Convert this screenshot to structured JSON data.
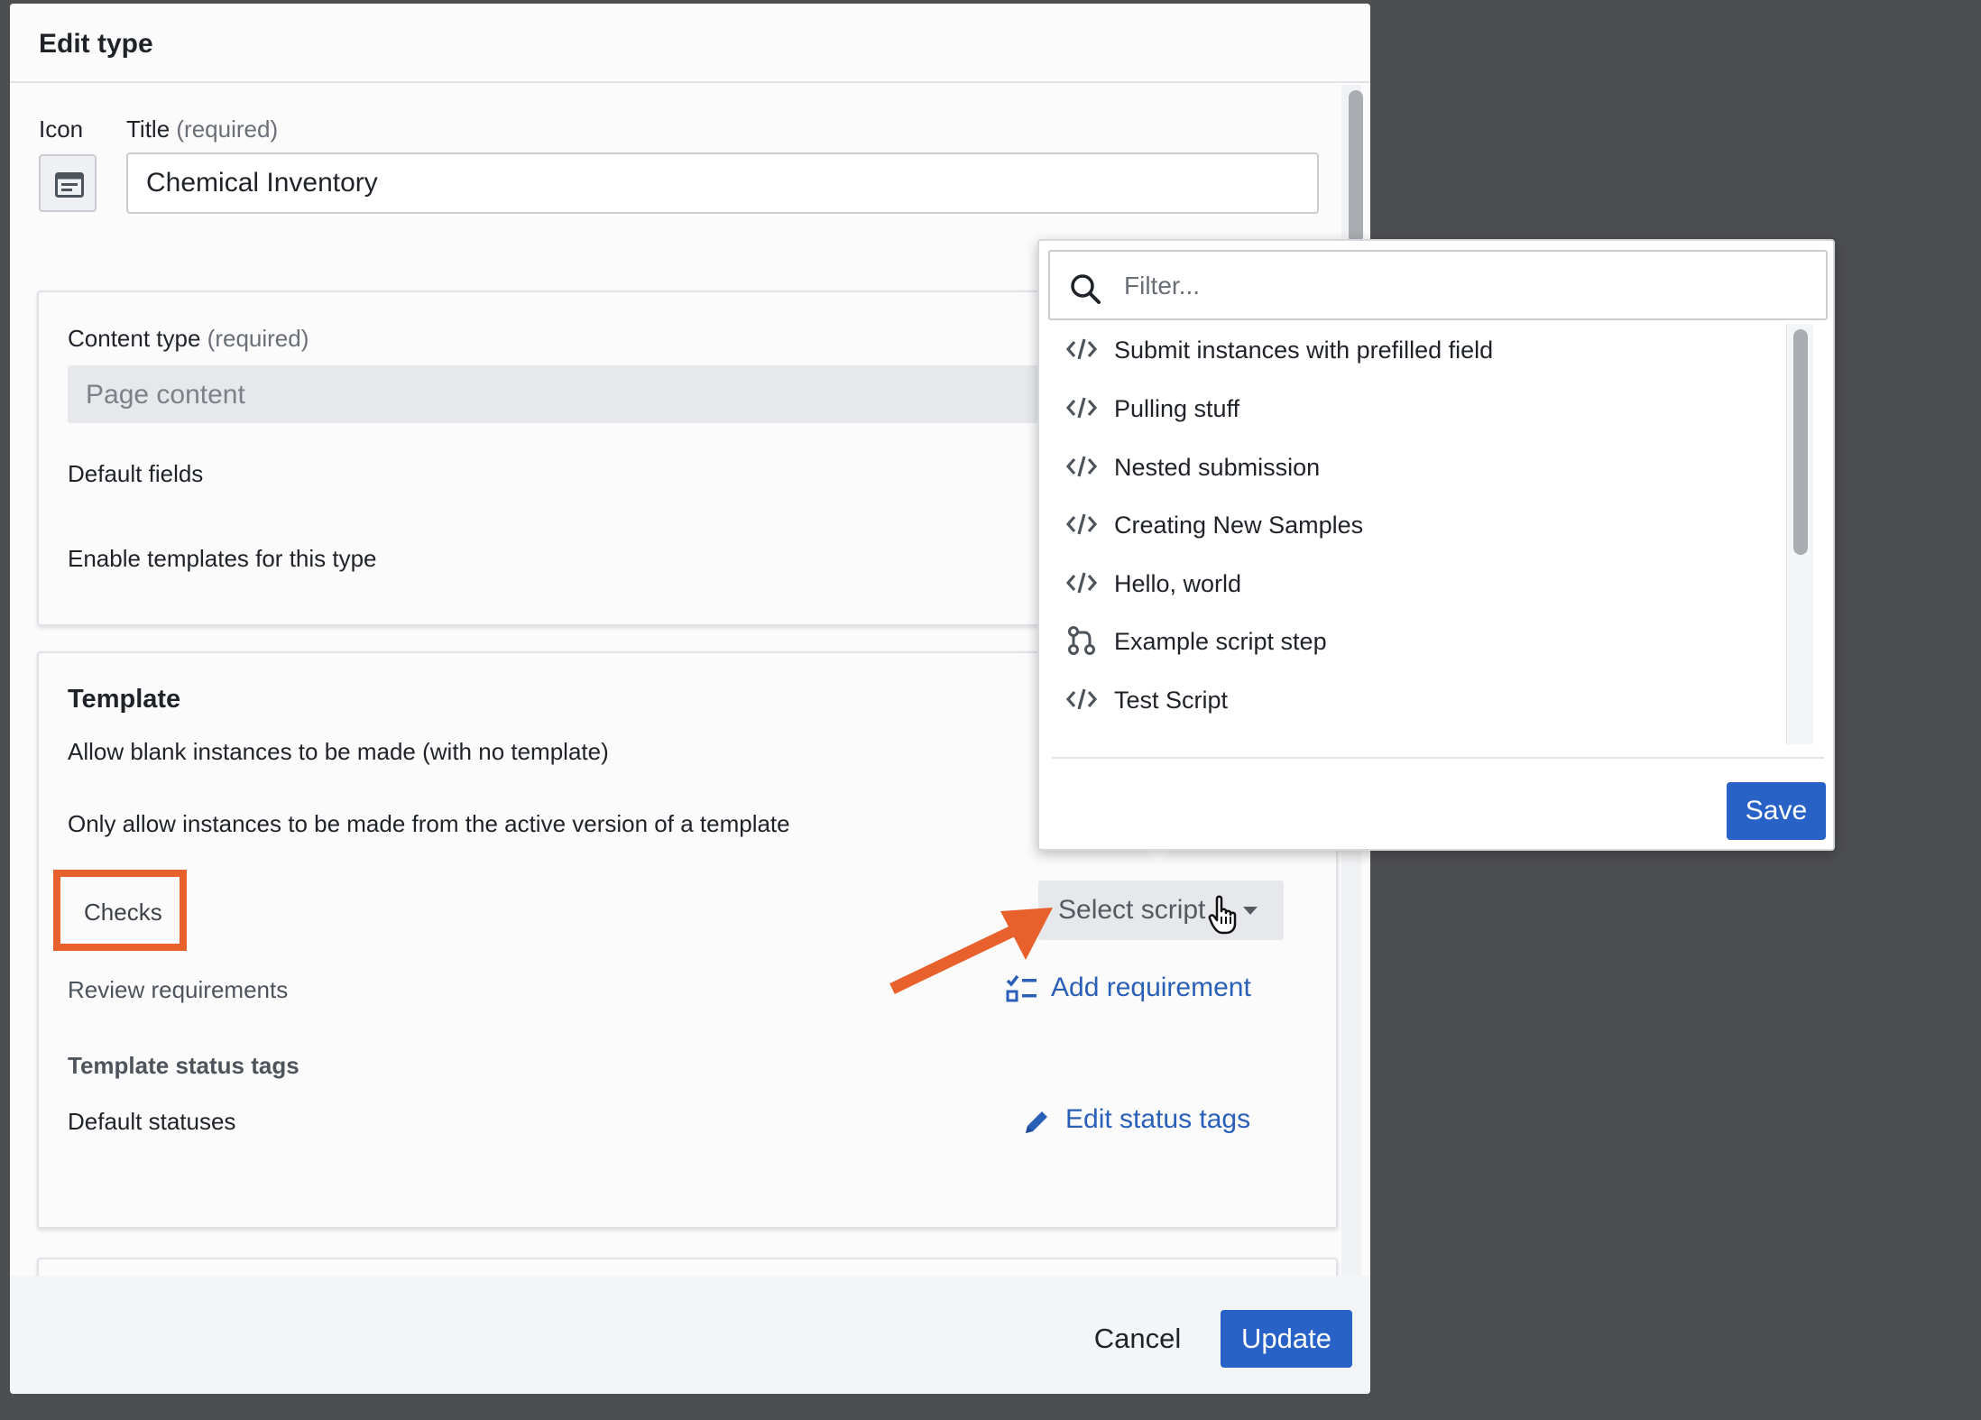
{
  "modal": {
    "title": "Edit type",
    "icon_label": "Icon",
    "title_label": "Title",
    "title_required": "(required)",
    "title_value": "Chemical Inventory"
  },
  "content_section": {
    "content_type_label": "Content type",
    "content_type_required": "(required)",
    "content_type_value": "Page content",
    "default_fields_label": "Default fields",
    "enable_templates_label": "Enable templates for this type"
  },
  "template_section": {
    "heading": "Template",
    "allow_blank_label": "Allow blank instances to be made (with no template)",
    "only_active_label": "Only allow instances to be made from the active version of a template",
    "checks_label": "Checks",
    "select_script_label": "Select script",
    "review_requirements_label": "Review requirements",
    "add_requirement_label": "Add requirement",
    "status_tags_heading": "Template status tags",
    "default_statuses_label": "Default statuses",
    "edit_status_tags_label": "Edit status tags"
  },
  "footer": {
    "cancel_label": "Cancel",
    "update_label": "Update"
  },
  "script_popover": {
    "filter_placeholder": "Filter...",
    "items": [
      {
        "label": "Submit instances with prefilled field",
        "icon": "code-icon"
      },
      {
        "label": "Pulling stuff",
        "icon": "code-icon"
      },
      {
        "label": "Nested submission",
        "icon": "code-icon"
      },
      {
        "label": "Creating New Samples",
        "icon": "code-icon"
      },
      {
        "label": "Hello, world",
        "icon": "code-icon"
      },
      {
        "label": "Example script step",
        "icon": "workflow-step-icon"
      },
      {
        "label": "Test Script",
        "icon": "code-icon"
      }
    ],
    "save_label": "Save"
  },
  "colors": {
    "primary": "#2962c6",
    "link": "#2a5fb8",
    "annotation": "#e8612c",
    "backdrop": "#4d4e50"
  }
}
